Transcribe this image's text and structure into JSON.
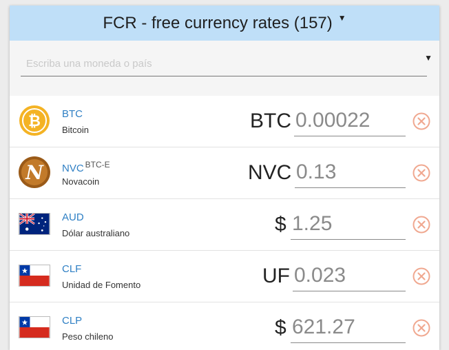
{
  "header": {
    "title": "FCR - free currency rates (157)"
  },
  "search": {
    "placeholder": "Escriba una moneda o país"
  },
  "rows": [
    {
      "code": "BTC",
      "exchange": "",
      "name": "Bitcoin",
      "symbol": "BTC",
      "value": "0.00022",
      "icon": "bitcoin-icon"
    },
    {
      "code": "NVC",
      "exchange": "BTC-E",
      "name": "Novacoin",
      "symbol": "NVC",
      "value": "0.13",
      "icon": "novacoin-icon"
    },
    {
      "code": "AUD",
      "exchange": "",
      "name": "Dólar australiano",
      "symbol": "$",
      "value": "1.25",
      "icon": "australia-flag-icon"
    },
    {
      "code": "CLF",
      "exchange": "",
      "name": "Unidad de Fomento",
      "symbol": "UF",
      "value": "0.023",
      "icon": "chile-flag-icon"
    },
    {
      "code": "CLP",
      "exchange": "",
      "name": "Peso chileno",
      "symbol": "$",
      "value": "621.27",
      "icon": "chile-flag-icon"
    }
  ],
  "colors": {
    "header_bg": "#bfdff8",
    "code": "#2e7fc4",
    "remove": "#f0a890",
    "bitcoin": "#f4b324",
    "novacoin": "#9a5a18"
  }
}
